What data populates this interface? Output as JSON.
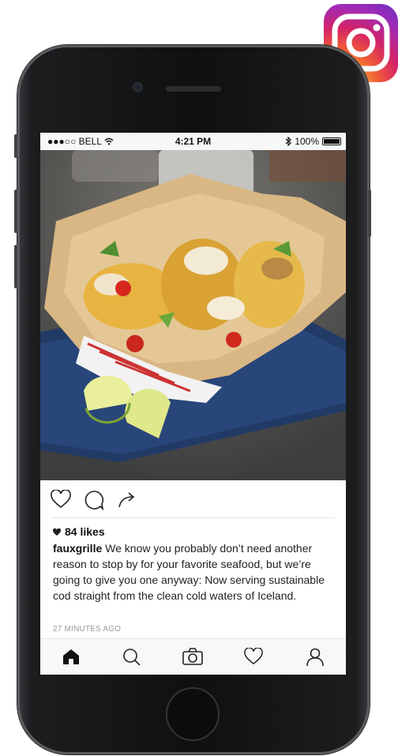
{
  "status_bar": {
    "carrier": "●●●○○ BELL",
    "time": "4:21 PM",
    "battery": "100%",
    "battery_level": 1.0
  },
  "post": {
    "likes": "84 likes",
    "username": "fauxgrille",
    "caption": " We know you probably don’t need another reason to stop by for your favorite seafood, but we’re going to give you one anyway: Now serving sustainable cod straight from the clean cold waters of Iceland.",
    "timestamp": "27 MINUTES AGO",
    "actions": [
      "like-icon",
      "comment-icon",
      "share-icon"
    ]
  },
  "tab_bar": {
    "items": [
      "home-icon",
      "search-icon",
      "camera-icon",
      "activity-heart-icon",
      "profile-icon"
    ],
    "active": "home-icon"
  },
  "colors": {
    "accent_text": "#111111",
    "muted_text": "#9a9a9a",
    "logo_gradient": [
      "#fdd775",
      "#f05a36",
      "#d3226a",
      "#6632c2"
    ]
  }
}
